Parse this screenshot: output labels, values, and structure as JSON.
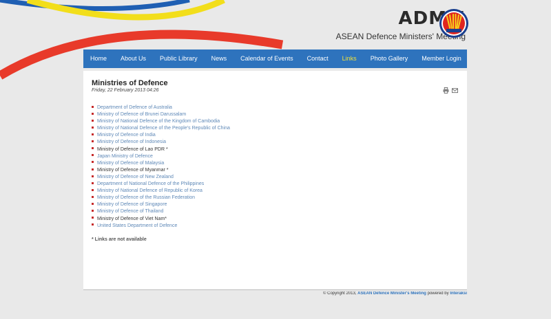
{
  "header": {
    "brand_title": "ADMM",
    "brand_subtitle": "ASEAN Defence Ministers' Meeting"
  },
  "nav": {
    "items": [
      {
        "label": "Home"
      },
      {
        "label": "About Us"
      },
      {
        "label": "Public Library"
      },
      {
        "label": "News"
      },
      {
        "label": "Calendar of Events"
      },
      {
        "label": "Contact"
      },
      {
        "label": "Links"
      },
      {
        "label": "Photo Gallery"
      },
      {
        "label": "Member Login"
      }
    ],
    "active_index": 6
  },
  "article": {
    "title": "Ministries of Defence",
    "date": "Friday, 22 February 2013 04:26",
    "links": [
      {
        "label": "Department of Defence of Australia",
        "linked": true
      },
      {
        "label": "Ministry of Defence of Brunei Darussalam",
        "linked": true
      },
      {
        "label": "Ministry of National Defence of the Kingdom of Cambodia",
        "linked": true
      },
      {
        "label": "Ministry of National Defence of the People’s Republic of China",
        "linked": true
      },
      {
        "label": "Ministry of Defence of India",
        "linked": true
      },
      {
        "label": "Ministry of Defence of Indonesia",
        "linked": true
      },
      {
        "label": "Ministry of Defence of Lao PDR *",
        "linked": false
      },
      {
        "label": "Japan Ministry of Defence",
        "linked": true
      },
      {
        "label": "Ministry of Defence of Malaysia",
        "linked": true
      },
      {
        "label": "Ministry of Defence of Myanmar *",
        "linked": false
      },
      {
        "label": "Ministry of Defence of New Zealand",
        "linked": true
      },
      {
        "label": "Department of National Defence of the Philippines",
        "linked": true
      },
      {
        "label": "Ministry of National Defence of Republic of Korea",
        "linked": true
      },
      {
        "label": "Ministry of Defence of the Russian Federation",
        "linked": true
      },
      {
        "label": "Ministry of Defence of Singapore",
        "linked": true
      },
      {
        "label": "Ministry of Defence of Thailand",
        "linked": true
      },
      {
        "label": "Ministry of Defence of Viet Nam*",
        "linked": false
      },
      {
        "label": "United States Department of Defence",
        "linked": true
      }
    ],
    "note": "* Links are not available"
  },
  "footer": {
    "copyright": "© Copyright 2013, ",
    "site_link": "ASEAN Defence Minister's Meeting",
    "powered_by": " powered by ",
    "vendor_link": "Interaksi"
  },
  "colors": {
    "nav_bg": "#2e73bd",
    "nav_active": "#f2e23a",
    "link": "#5e88b7",
    "bullet": "#c62b2b",
    "swoosh_blue": "#1f5fb3",
    "swoosh_yellow": "#f2de1b",
    "swoosh_red": "#e83a2a"
  }
}
